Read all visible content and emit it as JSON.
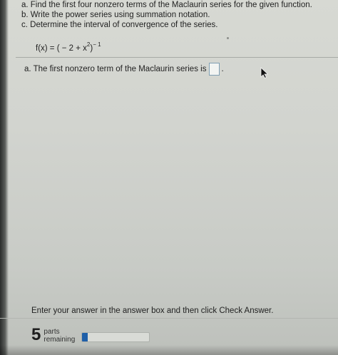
{
  "question": {
    "lines": [
      "a. Find the first four nonzero terms of the Maclaurin series for the given function.",
      "b. Write the power series using summation notation.",
      "c. Determine the interval of convergence of the series."
    ],
    "function": {
      "lhs": "f(x) = ",
      "base": "( − 2 + x",
      "inner_exponent": "2",
      "close": ")",
      "outer_exponent": "− 1"
    }
  },
  "answer": {
    "prompt": "a. The first nonzero term of the Maclaurin series is",
    "suffix": ".",
    "value": ""
  },
  "footer": {
    "instruction": "Enter your answer in the answer box and then click Check Answer.",
    "parts_count": "5",
    "parts_label_1": "parts",
    "parts_label_2": "remaining",
    "progress_fraction": 0.08
  },
  "colors": {
    "progress_fill": "#1f5fa8",
    "answer_box_border": "#7f9fb3"
  },
  "icons": {
    "cursor": "mouse-pointer-icon"
  }
}
